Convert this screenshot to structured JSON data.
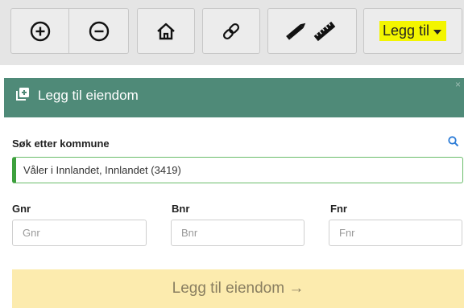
{
  "toolbar": {
    "buttons": [
      {
        "name": "zoom-in",
        "icon": "circle-plus-icon"
      },
      {
        "name": "zoom-out",
        "icon": "circle-minus-icon"
      },
      {
        "name": "home",
        "icon": "home-icon"
      },
      {
        "name": "link",
        "icon": "link-icon"
      },
      {
        "name": "draw-measure",
        "icon": "pencil-ruler-icon"
      }
    ],
    "add_label": "Legg til",
    "highlight_color": "#f3f500"
  },
  "panel": {
    "title": "Legg til eiendom",
    "close": "×",
    "header_color": "#4f8a78",
    "search": {
      "label": "Søk etter kommune",
      "value": "Våler i Innlandet, Innlandet (3419)"
    },
    "fields": [
      {
        "label": "Gnr",
        "placeholder": "Gnr"
      },
      {
        "label": "Bnr",
        "placeholder": "Bnr"
      },
      {
        "label": "Fnr",
        "placeholder": "Fnr"
      }
    ],
    "submit_label": "Legg til eiendom →"
  }
}
